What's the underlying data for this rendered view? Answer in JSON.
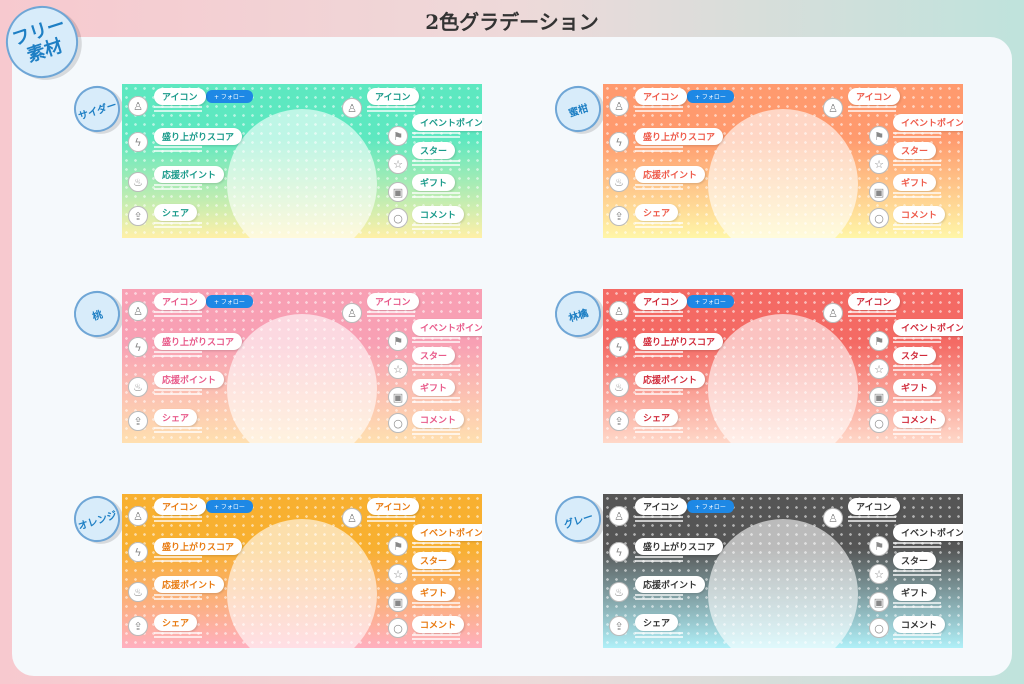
{
  "title": "2色グラデーション",
  "free_badge": "フリー素材",
  "follow_label": "+ フォロー",
  "left_items": [
    {
      "label": "アイコン",
      "icon": "person-icon"
    },
    {
      "label": "盛り上がりスコア",
      "icon": "lightning-icon"
    },
    {
      "label": "応援ポイント",
      "icon": "flame-icon"
    },
    {
      "label": "シェア",
      "icon": "share-icon"
    }
  ],
  "right_items": [
    {
      "label": "アイコン",
      "icon": "person-icon"
    },
    {
      "label": "イベントポイント",
      "icon": "flag-icon"
    },
    {
      "label": "スター",
      "icon": "star-icon"
    },
    {
      "label": "ギフト",
      "icon": "gift-icon"
    },
    {
      "label": "コメント",
      "icon": "comment-icon"
    }
  ],
  "variants": [
    {
      "name": "サイダー",
      "top": "#5de8c0",
      "bottom": "#fff0a8",
      "text": "#1a9a8a"
    },
    {
      "name": "蜜柑",
      "top": "#ff9a6e",
      "bottom": "#fff6a8",
      "text": "#ee5a4a"
    },
    {
      "name": "桃",
      "top": "#f8a0b4",
      "bottom": "#ffe0b0",
      "text": "#e85a8a"
    },
    {
      "name": "林檎",
      "top": "#f46a64",
      "bottom": "#ffd8c8",
      "text": "#d02a3a"
    },
    {
      "name": "オレンジ",
      "top": "#f8b030",
      "bottom": "#ffb0c0",
      "text": "#e87a10"
    },
    {
      "name": "グレー",
      "top": "#555555",
      "bottom": "#b0f0f8",
      "text": "#333333"
    }
  ]
}
